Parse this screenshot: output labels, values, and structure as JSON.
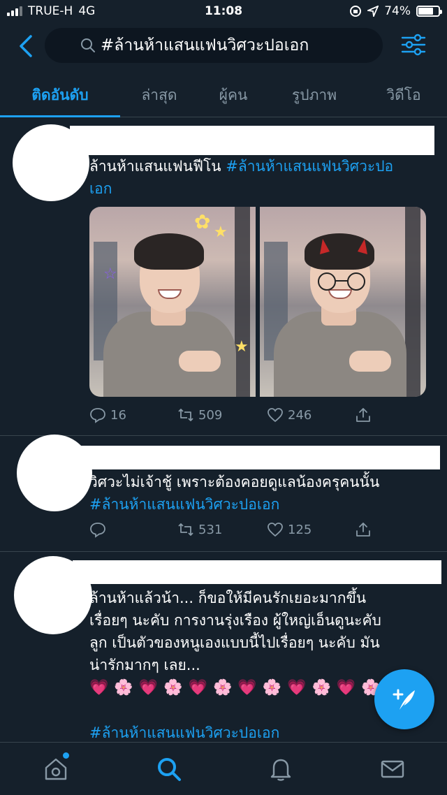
{
  "status_bar": {
    "carrier": "TRUE-H",
    "network": "4G",
    "time": "11:08",
    "battery_percent": "74%",
    "battery_level": 0.74
  },
  "search": {
    "query": "#ล้านห้าแสนแฟนวิศวะปอเอก"
  },
  "tabs": [
    {
      "label": "ติดอันดับ",
      "active": true
    },
    {
      "label": "ล่าสุด",
      "active": false
    },
    {
      "label": "ผู้คน",
      "active": false
    },
    {
      "label": "รูปภาพ",
      "active": false
    },
    {
      "label": "วิดีโอ",
      "active": false
    }
  ],
  "tweets": [
    {
      "text": "ล้านห้าแสนแฟนฟีโน ",
      "hashtag": "#ล้านห้าแสนแฟนวิศวะปอ",
      "hashtag_cont": "เอก",
      "replies": "16",
      "retweets": "509",
      "likes": "246"
    },
    {
      "text": "วิศวะไม่เจ้าชู้  เพราะต้องคอยดูแลน้องครุคนนั้น",
      "hashtag": "#ล้านห้าแสนแฟนวิศวะปอเอก",
      "replies": "",
      "retweets": "531",
      "likes": "125"
    },
    {
      "line1": "ล้านห้าแล้วน้า... ก็ขอให้มีคนรักเยอะมากขึ้น",
      "line2": "เรื่อยๆ นะคับ การงานรุ่งเรือง ผู้ใหญ่เอ็นดูนะคับ",
      "line3": "ลูก เป็นตัวของหนูเองแบบนี้ไปเรื่อยๆ นะคับ มัน",
      "line4": "น่ารักมากๆ เลย...",
      "emoji_row": "💗🌸💗🌸💗🌸💗🌸💗🌸💗🌸",
      "hashtag": "#ล้านห้าแสนแฟนวิศวะปอเอก"
    }
  ],
  "icons": {
    "back": "chevron-left-icon",
    "search": "search-icon",
    "filter": "sliders-icon",
    "reply": "reply-icon",
    "retweet": "retweet-icon",
    "like": "heart-icon",
    "share": "share-icon",
    "compose": "compose-icon",
    "home": "home-icon",
    "explore": "search-icon",
    "notifications": "bell-icon",
    "messages": "mail-icon"
  },
  "colors": {
    "background": "#15202b",
    "accent": "#1da1f2",
    "muted": "#8899a6"
  }
}
